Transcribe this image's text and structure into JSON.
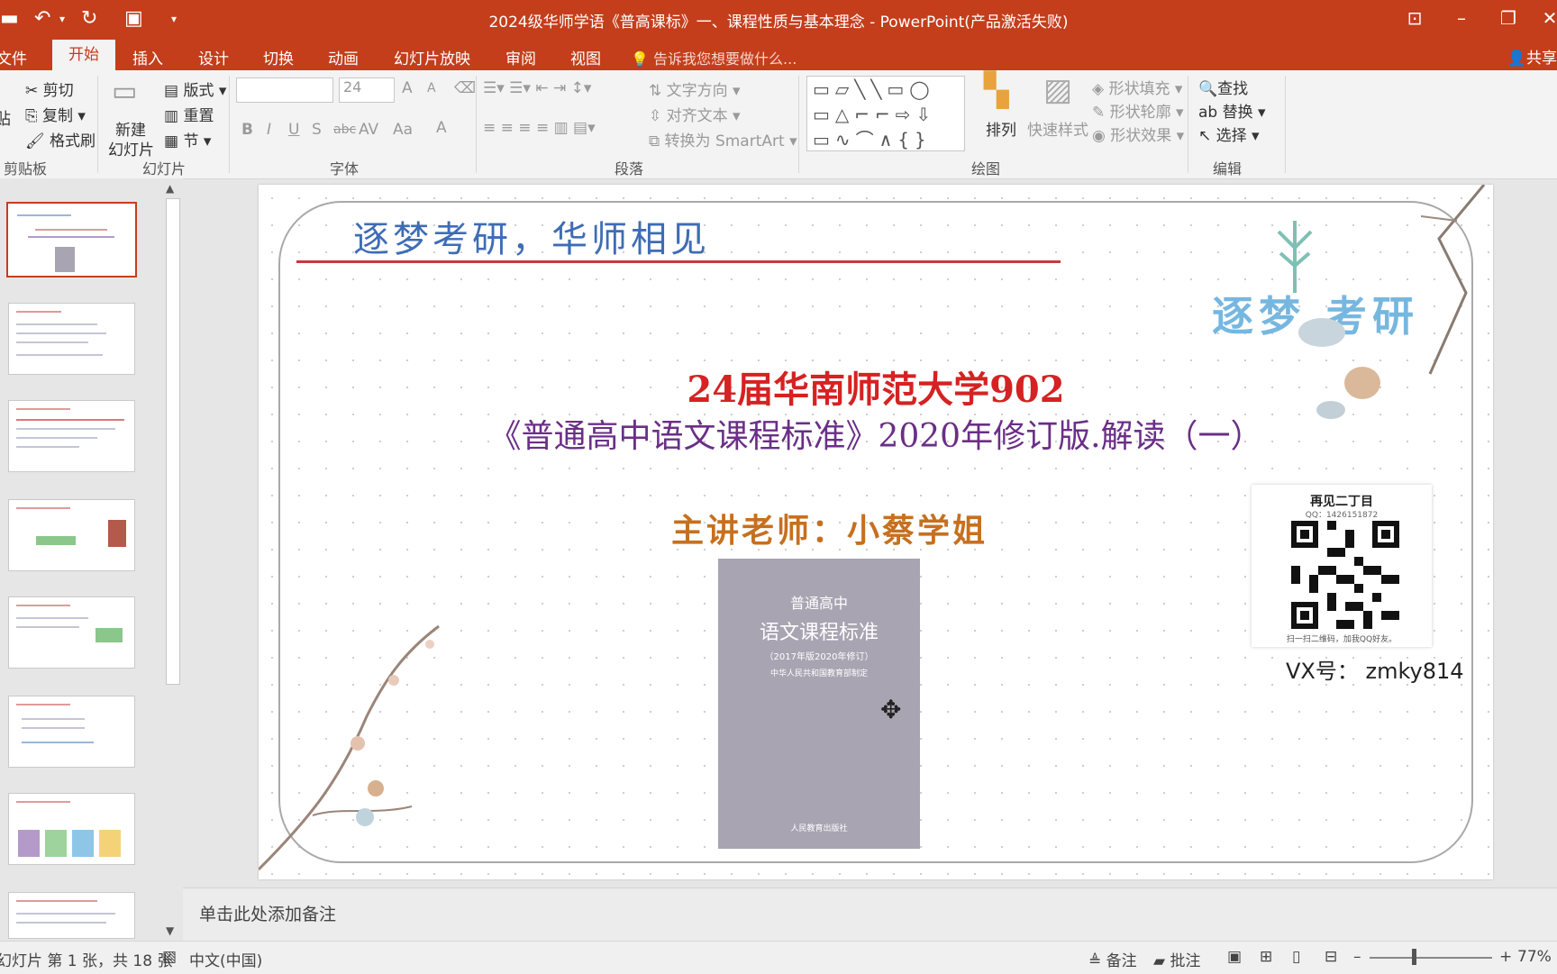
{
  "window": {
    "title": "2024级华师学语《普高课标》一、课程性质与基本理念 - PowerPoint(产品激活失败)",
    "share_label": "共享"
  },
  "quick_access": {
    "icons": [
      "save-icon",
      "undo-icon",
      "redo-icon",
      "present-icon",
      "customize-icon"
    ]
  },
  "tabs": [
    {
      "label": "文件"
    },
    {
      "label": "开始"
    },
    {
      "label": "插入"
    },
    {
      "label": "设计"
    },
    {
      "label": "切换"
    },
    {
      "label": "动画"
    },
    {
      "label": "幻灯片放映"
    },
    {
      "label": "审阅"
    },
    {
      "label": "视图"
    }
  ],
  "tell_me": {
    "placeholder": "告诉我您想要做什么..."
  },
  "ribbon": {
    "clipboard": {
      "paste": "贴",
      "cut": "剪切",
      "copy": "复制",
      "format_painter": "格式刷",
      "group": "剪贴板"
    },
    "slides": {
      "new_slide_1": "新建",
      "new_slide_2": "幻灯片",
      "layout": "版式",
      "reset": "重置",
      "section": "节",
      "group": "幻灯片"
    },
    "font": {
      "font_name": "",
      "font_size": "24",
      "bold": "B",
      "italic": "I",
      "underline": "U",
      "shadow": "S",
      "strike": "abc",
      "spacing": "AV",
      "case": "Aa",
      "color": "A",
      "grow": "A",
      "shrink": "A",
      "group": "字体"
    },
    "paragraph": {
      "text_direction": "文字方向",
      "align_text": "对齐文本",
      "smartart": "转换为 SmartArt",
      "group": "段落"
    },
    "drawing": {
      "arrange": "排列",
      "quick_styles": "快速样式",
      "fill": "形状填充",
      "outline": "形状轮廓",
      "effects": "形状效果",
      "group": "绘图"
    },
    "editing": {
      "find": "查找",
      "replace": "替换",
      "select": "选择",
      "group": "编辑"
    }
  },
  "slide": {
    "slogan": "逐梦考研，华师相见",
    "logo_text": "逐梦 考研",
    "title_line1": "24届华南师范大学902",
    "title_line2": "《普通高中语文课程标准》2020年修订版.解读（一）",
    "teacher": "主讲老师：小蔡学姐",
    "book": {
      "line1": "普通高中",
      "line2": "语文课程标准",
      "line3": "（2017年版2020年修订）",
      "line4": "中华人民共和国教育部制定",
      "publisher": "人民教育出版社"
    },
    "qr": {
      "name": "再见二丁目",
      "qq": "QQ：1426151872",
      "scan_hint": "扫一扫二维码，加我QQ好友。"
    },
    "vx": "VX号：  zmky814"
  },
  "notes": {
    "placeholder": "单击此处添加备注"
  },
  "status": {
    "slide_info": "幻灯片 第 1 张，共 18 张",
    "language": "中文(中国)",
    "notes": "备注",
    "comments": "批注",
    "zoom": "77%"
  },
  "thumbnails": {
    "count_visible": 8,
    "selected_index": 1
  },
  "colors": {
    "accent": "#c43e1c",
    "slogan": "#3f6cb4",
    "title_red": "#d52222",
    "title_purple": "#6a2f86",
    "teacher": "#c6701f"
  }
}
